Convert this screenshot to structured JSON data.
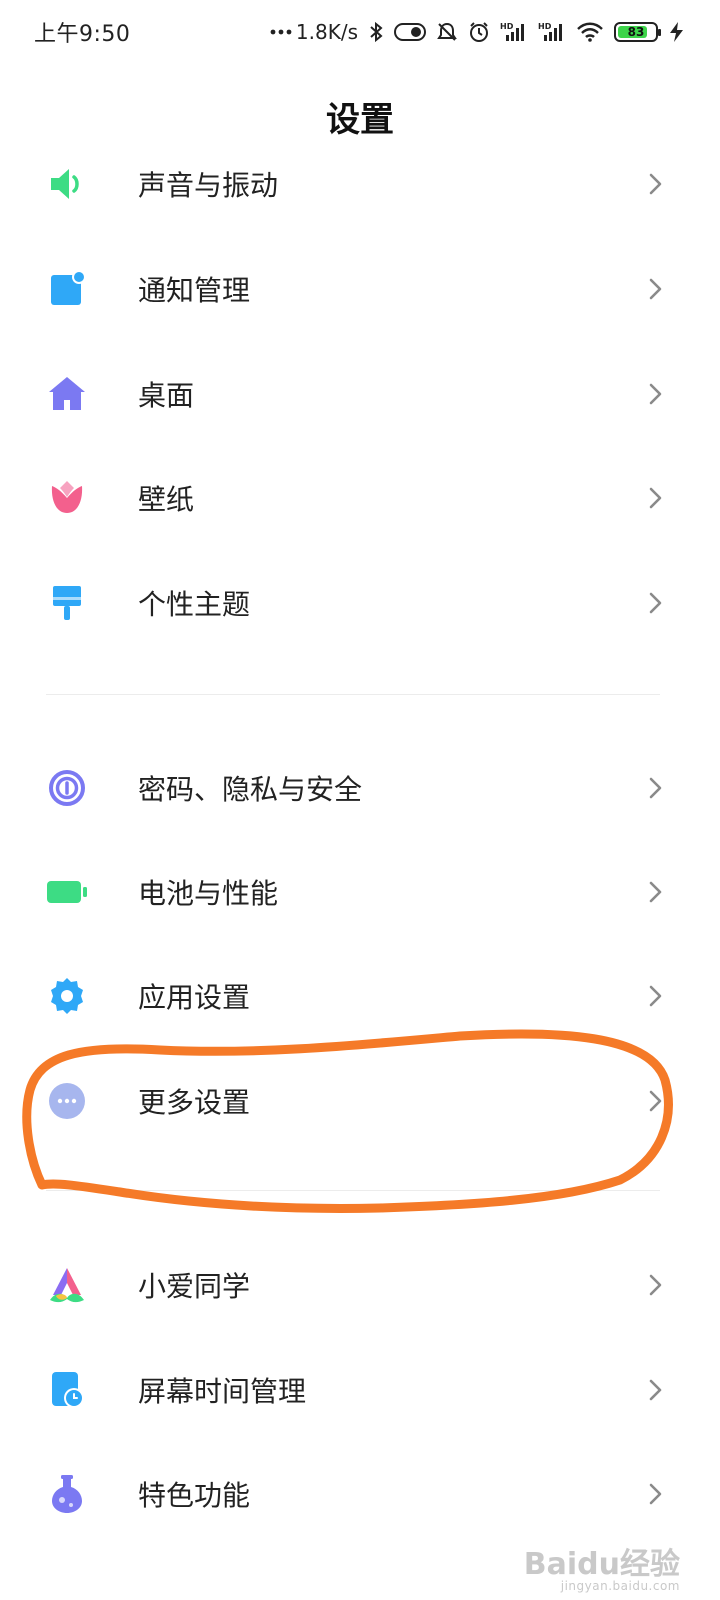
{
  "status_bar": {
    "time": "上午9:50",
    "network_speed": "1.8K/s",
    "battery_level": "83",
    "battery_fraction": 0.83,
    "icons": [
      "dots-icon",
      "bluetooth-icon",
      "toggle-icon",
      "mute-icon",
      "alarm-icon",
      "hd-signal-icon",
      "hd-signal-icon",
      "wifi-icon",
      "battery-icon",
      "charging-icon"
    ]
  },
  "page": {
    "title": "设置"
  },
  "colors": {
    "green": "#3ddc84",
    "blue": "#2fa8f7",
    "purple": "#7b79f2",
    "pink": "#f3608d",
    "orange_annotation": "#f57a28"
  },
  "settings": {
    "items": [
      {
        "label": "声音与振动",
        "icon": "speaker-icon"
      },
      {
        "label": "通知管理",
        "icon": "notification-icon"
      },
      {
        "label": "桌面",
        "icon": "home-icon"
      },
      {
        "label": "壁纸",
        "icon": "tulip-icon"
      },
      {
        "label": "个性主题",
        "icon": "paintbrush-icon"
      },
      {
        "label": "密码、隐私与安全",
        "icon": "fingerprint-icon"
      },
      {
        "label": "电池与性能",
        "icon": "battery-icon"
      },
      {
        "label": "应用设置",
        "icon": "gear-icon"
      },
      {
        "label": "更多设置",
        "icon": "more-dots-icon"
      },
      {
        "label": "小爱同学",
        "icon": "xiaoai-icon"
      },
      {
        "label": "屏幕时间管理",
        "icon": "screen-time-icon"
      },
      {
        "label": "特色功能",
        "icon": "flask-icon"
      }
    ]
  },
  "watermark": {
    "brand": "Baidu经验",
    "url": "jingyan.baidu.com"
  }
}
